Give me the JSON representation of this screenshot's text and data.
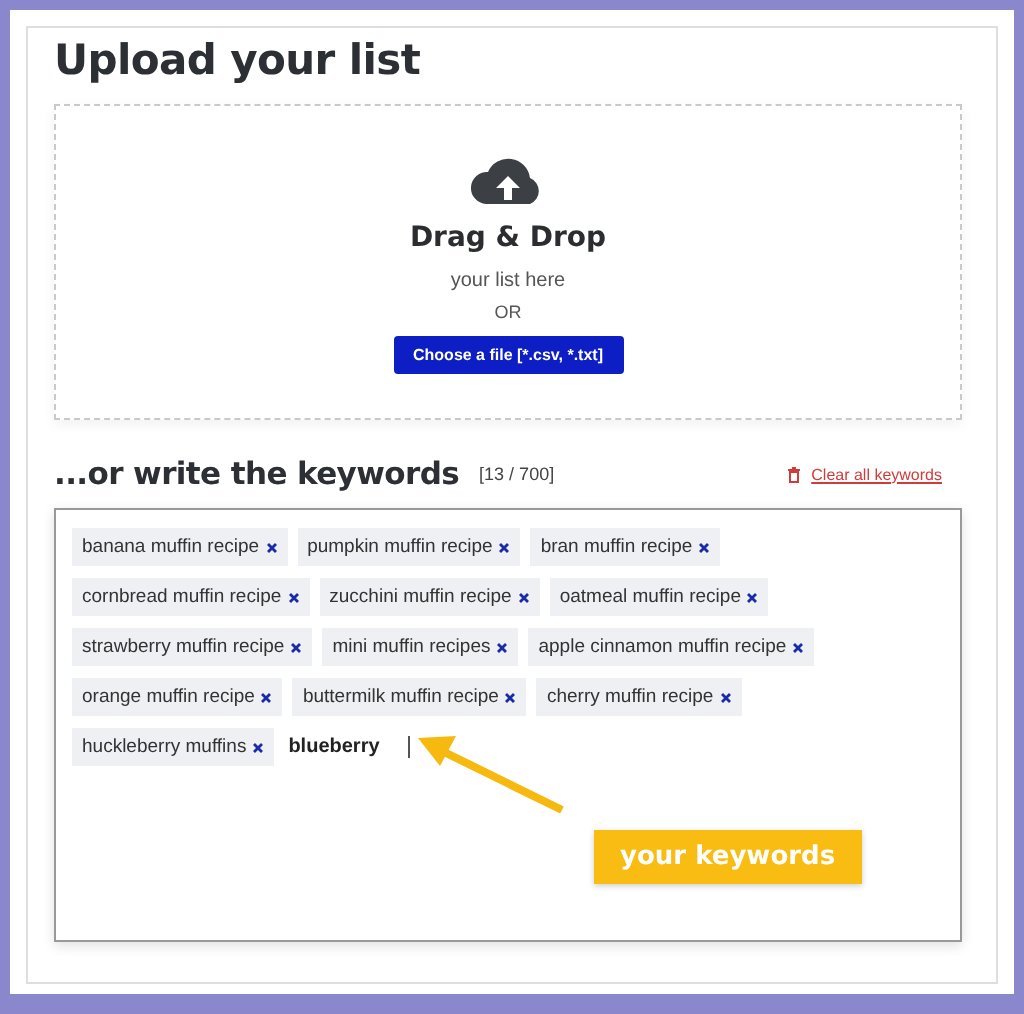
{
  "upload": {
    "title": "Upload your list",
    "drop_title": "Drag & Drop",
    "drop_hint": "your list here",
    "separator": "OR",
    "choose_button": "Choose a file [*.csv, *.txt]"
  },
  "keywords": {
    "title": "...or write the keywords",
    "counter": "[13 / 700]",
    "clear_link": "Clear all keywords",
    "tags": [
      "banana muffin recipe",
      "pumpkin muffin recipe",
      "bran muffin recipe",
      "cornbread muffin recipe",
      "zucchini muffin recipe",
      "oatmeal muffin recipe",
      "strawberry muffin recipe",
      "mini muffin recipes",
      "apple cinnamon muffin recipe",
      "orange muffin recipe",
      "buttermilk muffin recipe",
      "cherry muffin recipe",
      "huckleberry muffins"
    ],
    "input_value": "blueberry"
  },
  "annotation": {
    "label": "your keywords"
  }
}
